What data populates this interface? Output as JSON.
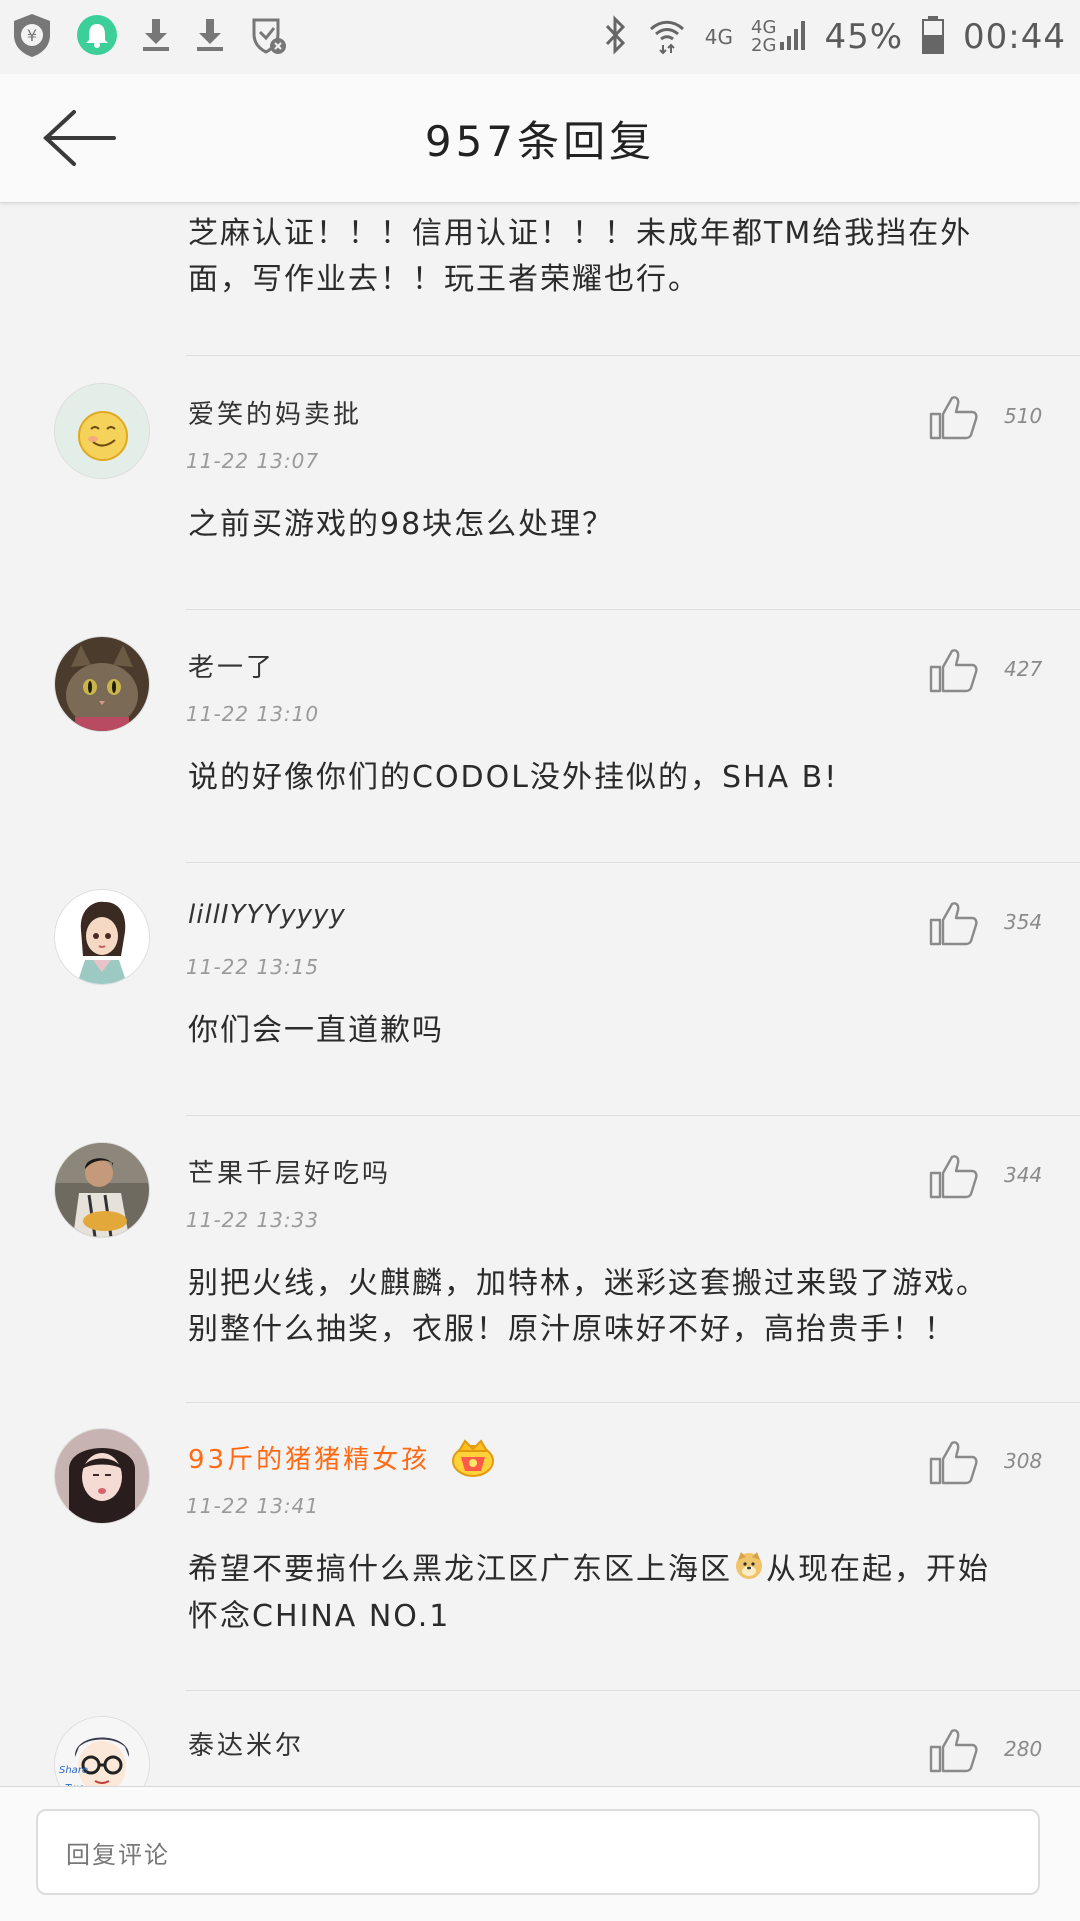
{
  "status_bar": {
    "icons_left": [
      "shield-yen-icon",
      "bell-icon",
      "download-icon",
      "download-icon",
      "shield-x-icon"
    ],
    "network_4g": "4G",
    "network_4g_2g_top": "4G",
    "network_4g_2g_bottom": "2G",
    "battery_percent": "45%",
    "time": "00:44",
    "accent_green": "#3ccf9a"
  },
  "header": {
    "title": "957条回复",
    "back_icon": "back-arrow-icon"
  },
  "partial_comment": {
    "content": "芝麻认证！！！信用认证！！！未成年都TM给我挡在外面，写作业去！！玩王者荣耀也行。"
  },
  "comments": [
    {
      "username": "爱笑的妈卖批",
      "time": "11-22 13:07",
      "content": "之前买游戏的98块怎么处理？",
      "likes": "510"
    },
    {
      "username": "老一了",
      "time": "11-22 13:10",
      "content": "说的好像你们的CODOL没外挂似的，SHA B!",
      "likes": "427"
    },
    {
      "username": "lillIYYYyyyy",
      "time": "11-22 13:15",
      "content": "你们会一直道歉吗",
      "likes": "354"
    },
    {
      "username": "芒果千层好吃吗",
      "time": "11-22 13:33",
      "content": "别把火线，火麒麟，加特林，迷彩这套搬过来毁了游戏。 别整什么抽奖，衣服！原汁原味好不好，高抬贵手！！",
      "likes": "344"
    },
    {
      "username": "93斤的猪猪精女孩",
      "time": "11-22 13:41",
      "content_before": "希望不要搞什么黑龙江区广东区上海区",
      "content_after": "从现在起，开始怀念CHINA NO.1",
      "likes": "308",
      "vip_color": "#ff6a13"
    },
    {
      "username": "泰达米尔",
      "time": "",
      "likes": "280"
    }
  ],
  "reply_bar": {
    "placeholder": "回复评论"
  }
}
